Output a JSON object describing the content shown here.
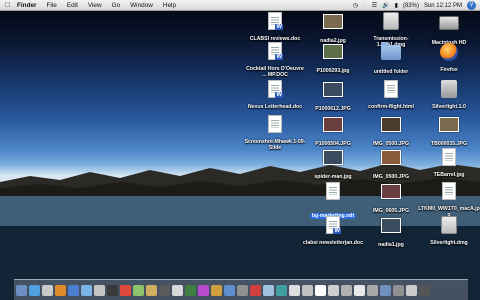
{
  "menubar": {
    "apple": "",
    "items": [
      "Finder",
      "File",
      "Edit",
      "View",
      "Go",
      "Window",
      "Help"
    ],
    "battery": "(83%)",
    "clock": "Sun 12:12 PM"
  },
  "desktop": {
    "icons": [
      {
        "label": "CLABSI reviews.doc",
        "kind": "word"
      },
      {
        "label": "nadia2.jpg",
        "kind": "photo"
      },
      {
        "label": "Transmission-1.74b1.dmg",
        "kind": "dmg"
      },
      {
        "label": "Macintosh HD",
        "kind": "drive"
      },
      {
        "label": "Cocktail Hors D'Oeuvre ... MP.DOC",
        "kind": "word"
      },
      {
        "label": "P1000293.jpg",
        "kind": "photo"
      },
      {
        "label": "untitled folder",
        "kind": "folder"
      },
      {
        "label": "Firefox",
        "kind": "browser"
      },
      {
        "label": "Nexus Letterhead.doc",
        "kind": "word"
      },
      {
        "label": "P1000612.JPG",
        "kind": "photo"
      },
      {
        "label": "confirm-flight.html",
        "kind": "doc"
      },
      {
        "label": "Silverlight.1.0",
        "kind": "silverlight"
      },
      {
        "label": "Screenshot-Mhawk 1-09-Slide",
        "kind": "doc"
      },
      {
        "label": "P1000504.JPG",
        "kind": "photo"
      },
      {
        "label": "IMG_0500.JPG",
        "kind": "photo"
      },
      {
        "label": "TB000035.JPG",
        "kind": "photo"
      },
      {
        "label": "spider-man.jpg",
        "kind": "photo"
      },
      {
        "label": "IMG_0500.JPG",
        "kind": "photo"
      },
      {
        "label": "TEBarrel.jpg",
        "kind": "doc"
      },
      {
        "label": "bg-marketing.odt",
        "kind": "doc",
        "selected": true
      },
      {
        "label": "IMG_0605.JPG",
        "kind": "photo"
      },
      {
        "label": "LTKM0_WW1T0_macA.jpg",
        "kind": "doc"
      },
      {
        "label": "clabsi newsletterjan.doc",
        "kind": "word"
      },
      {
        "label": "nadia1.jpg",
        "kind": "photo"
      },
      {
        "label": "Silverlight.dmg",
        "kind": "dmg"
      }
    ]
  },
  "colors": {
    "selection": "#2c6be0",
    "menubar": "#e6e6e6"
  }
}
